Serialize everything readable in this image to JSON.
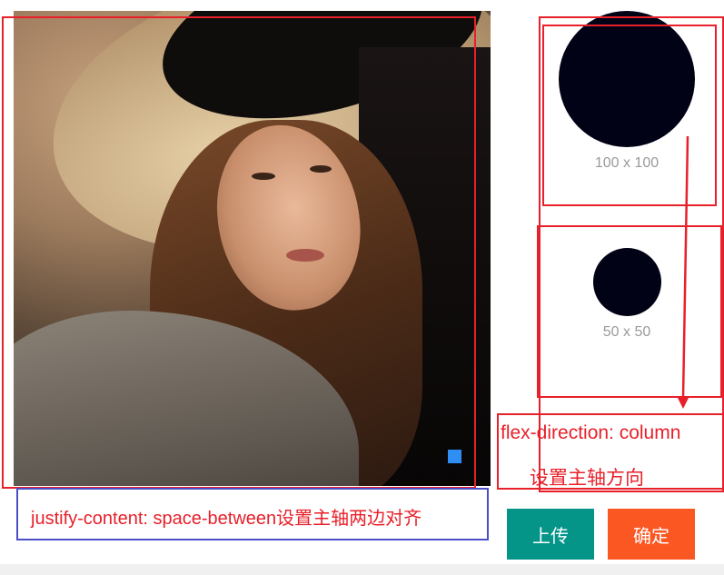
{
  "photo": {
    "alt": "cropper-source-image",
    "handle_color": "#2f8ef4"
  },
  "previews": [
    {
      "size_label": "100 x 100"
    },
    {
      "size_label": "50 x 50"
    }
  ],
  "annotations": {
    "justify_text": "justify-content: space-between设置主轴两边对齐",
    "flex_direction_text": "flex-direction: column",
    "flex_direction_cn": "设置主轴方向",
    "red_color": "#e8202a",
    "blue_color": "#4a4fc7"
  },
  "buttons": {
    "upload_label": "上传",
    "confirm_label": "确定",
    "upload_color": "#049588",
    "confirm_color": "#fb5722"
  }
}
